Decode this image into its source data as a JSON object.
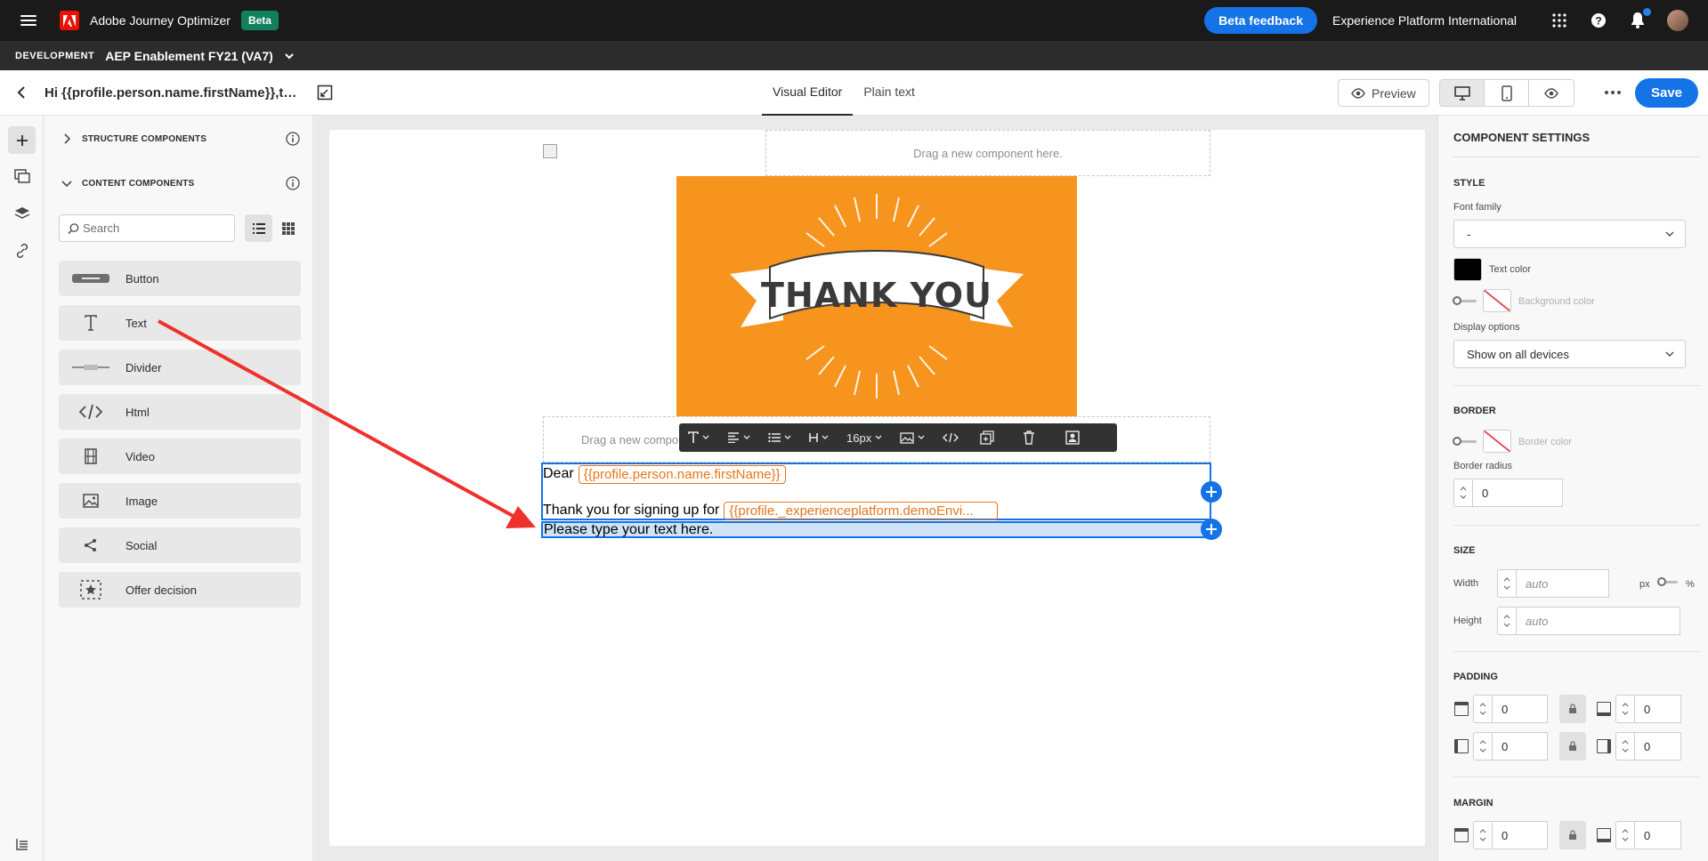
{
  "topbar": {
    "app_name": "Adobe Journey Optimizer",
    "beta_badge": "Beta",
    "beta_feedback": "Beta feedback",
    "org_name": "Experience Platform International"
  },
  "sandbox": {
    "env_label": "DEVELOPMENT",
    "name": "AEP Enablement FY21 (VA7)"
  },
  "toolbar": {
    "doc_title": "Hi {{profile.person.name.firstName}},than...",
    "tabs": [
      "Visual Editor",
      "Plain text"
    ],
    "active_tab": "Visual Editor",
    "preview_label": "Preview",
    "save_label": "Save"
  },
  "components_panel": {
    "structure_label": "STRUCTURE COMPONENTS",
    "content_label": "CONTENT COMPONENTS",
    "search_placeholder": "Search",
    "items": [
      {
        "label": "Button",
        "icon": "button-icon"
      },
      {
        "label": "Text",
        "icon": "text-icon"
      },
      {
        "label": "Divider",
        "icon": "divider-icon"
      },
      {
        "label": "Html",
        "icon": "code-icon"
      },
      {
        "label": "Video",
        "icon": "film-icon"
      },
      {
        "label": "Image",
        "icon": "image-icon"
      },
      {
        "label": "Social",
        "icon": "share-icon"
      },
      {
        "label": "Offer decision",
        "icon": "offer-icon"
      }
    ]
  },
  "canvas": {
    "drop_zone_top": "Drag a new component here.",
    "drop_zone_mid": "Drag a new compo",
    "hero_text": "THANK YOU",
    "dear": "Dear",
    "token_firstname": "{{profile.person.name.firstName}}",
    "thanks_prefix": "Thank you for signing up for",
    "token_demo": "{{profile._experienceplatform.demoEnvi...",
    "new_text": "Please type your text here.",
    "toolbar_font_size": "16px"
  },
  "settings": {
    "title": "COMPONENT SETTINGS",
    "style_label": "STYLE",
    "font_family_label": "Font family",
    "font_family_value": "-",
    "text_color_label": "Text color",
    "text_color": "#000000",
    "background_color_label": "Background color",
    "display_options_label": "Display options",
    "display_options_value": "Show on all devices",
    "border_label": "BORDER",
    "border_color_label": "Border color",
    "border_radius_label": "Border radius",
    "border_radius_value": "0",
    "size_label": "SIZE",
    "width_label": "Width",
    "width_placeholder": "auto",
    "unit_px": "px",
    "unit_pct": "%",
    "height_label": "Height",
    "height_placeholder": "auto",
    "padding_label": "PADDING",
    "padding_values": [
      "0",
      "0",
      "0",
      "0"
    ],
    "margin_label": "MARGIN",
    "margin_values": [
      "0",
      "0"
    ]
  },
  "colors": {
    "accent": "#1473e6",
    "hero_orange": "#f7941d",
    "token_orange": "#e8741a",
    "annotation_arrow": "#f0302a"
  }
}
